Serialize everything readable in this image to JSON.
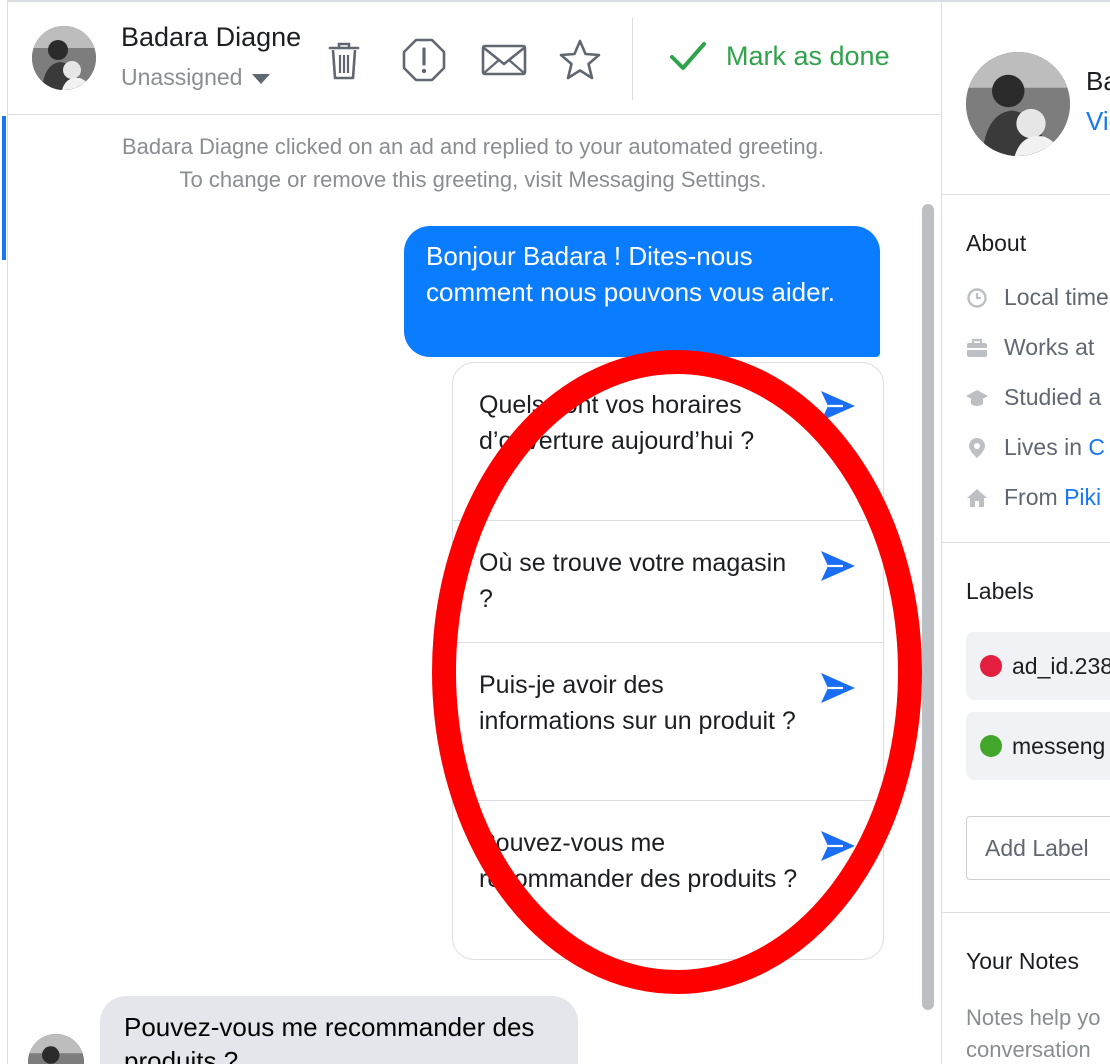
{
  "header": {
    "contact_name": "Badara Diagne",
    "assignment": "Unassigned",
    "icons": [
      "trash-icon",
      "alert-icon",
      "mail-icon",
      "star-icon"
    ],
    "mark_done_label": "Mark as done"
  },
  "conversation": {
    "notice_line1": "Badara Diagne clicked on an ad and replied to your automated greeting.",
    "notice_line2": "To change or remove this greeting, visit Messaging Settings.",
    "greeting_message": "Bonjour Badara ! Dites-nous comment nous pouvons vous aider.",
    "quick_replies": [
      "Quels sont vos horaires d’ouverture aujourd’hui ?",
      "Où se trouve votre magasin ?",
      "Puis-je avoir des informations sur un produit ?",
      "Pouvez-vous me recommander des produits ?"
    ],
    "customer_message": "Pouvez-vous me recommander des produits ?"
  },
  "panel": {
    "name": "Ba",
    "view_link": "Vie",
    "about_title": "About",
    "about_rows": [
      {
        "icon": "clock-icon",
        "text": "Local time",
        "link": ""
      },
      {
        "icon": "briefcase-icon",
        "text": "Works at",
        "link": ""
      },
      {
        "icon": "graduation-cap-icon",
        "text": "Studied a",
        "link": ""
      },
      {
        "icon": "location-pin-icon",
        "text": "Lives in ",
        "link": "C"
      },
      {
        "icon": "home-icon",
        "text": "From ",
        "link": "Piki"
      }
    ],
    "labels_title": "Labels",
    "labels": [
      {
        "text": "ad_id.238",
        "color": "#e41e3f"
      },
      {
        "text": "messeng",
        "color": "#42a62a"
      }
    ],
    "add_label": "Add Label",
    "notes_title": "Your Notes",
    "notes_help_line1": "Notes help yo",
    "notes_help_line2": "conversation"
  },
  "colors": {
    "accent": "#1877f2",
    "outgoing_bubble": "#0a7cff",
    "done_green": "#31a24c",
    "annotation_red": "#ff0000"
  }
}
